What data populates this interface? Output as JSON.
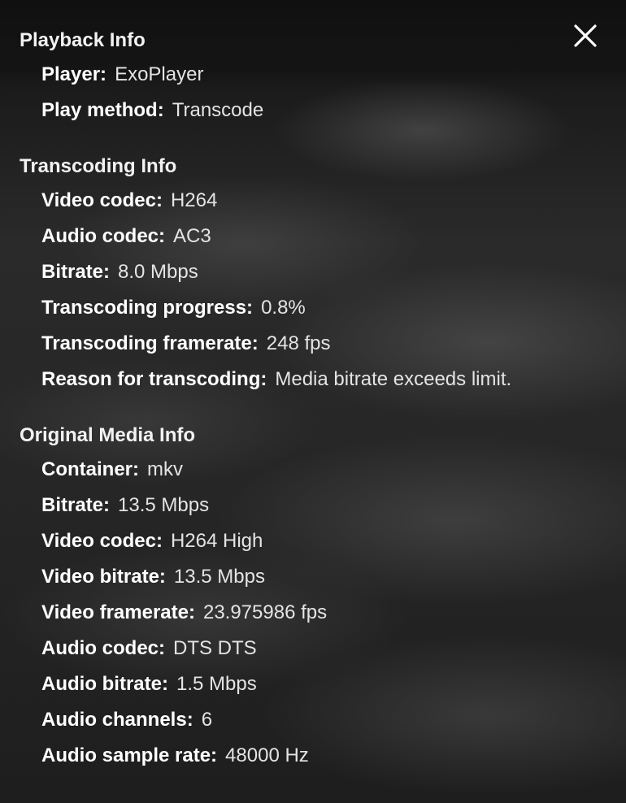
{
  "close_icon": "close-icon",
  "sections": [
    {
      "title": "Playback Info",
      "rows": [
        {
          "label": "Player:",
          "value": "ExoPlayer"
        },
        {
          "label": "Play method:",
          "value": "Transcode"
        }
      ]
    },
    {
      "title": "Transcoding Info",
      "rows": [
        {
          "label": "Video codec:",
          "value": "H264"
        },
        {
          "label": "Audio codec:",
          "value": "AC3"
        },
        {
          "label": "Bitrate:",
          "value": "8.0 Mbps"
        },
        {
          "label": "Transcoding progress:",
          "value": "0.8%"
        },
        {
          "label": "Transcoding framerate:",
          "value": "248 fps"
        },
        {
          "label": "Reason for transcoding:",
          "value": "Media bitrate exceeds limit."
        }
      ]
    },
    {
      "title": "Original Media Info",
      "rows": [
        {
          "label": "Container:",
          "value": "mkv"
        },
        {
          "label": "Bitrate:",
          "value": "13.5 Mbps"
        },
        {
          "label": "Video codec:",
          "value": "H264 High"
        },
        {
          "label": "Video bitrate:",
          "value": "13.5 Mbps"
        },
        {
          "label": "Video framerate:",
          "value": "23.975986 fps"
        },
        {
          "label": "Audio codec:",
          "value": "DTS DTS"
        },
        {
          "label": "Audio bitrate:",
          "value": "1.5 Mbps"
        },
        {
          "label": "Audio channels:",
          "value": "6"
        },
        {
          "label": "Audio sample rate:",
          "value": "48000 Hz"
        }
      ]
    }
  ]
}
